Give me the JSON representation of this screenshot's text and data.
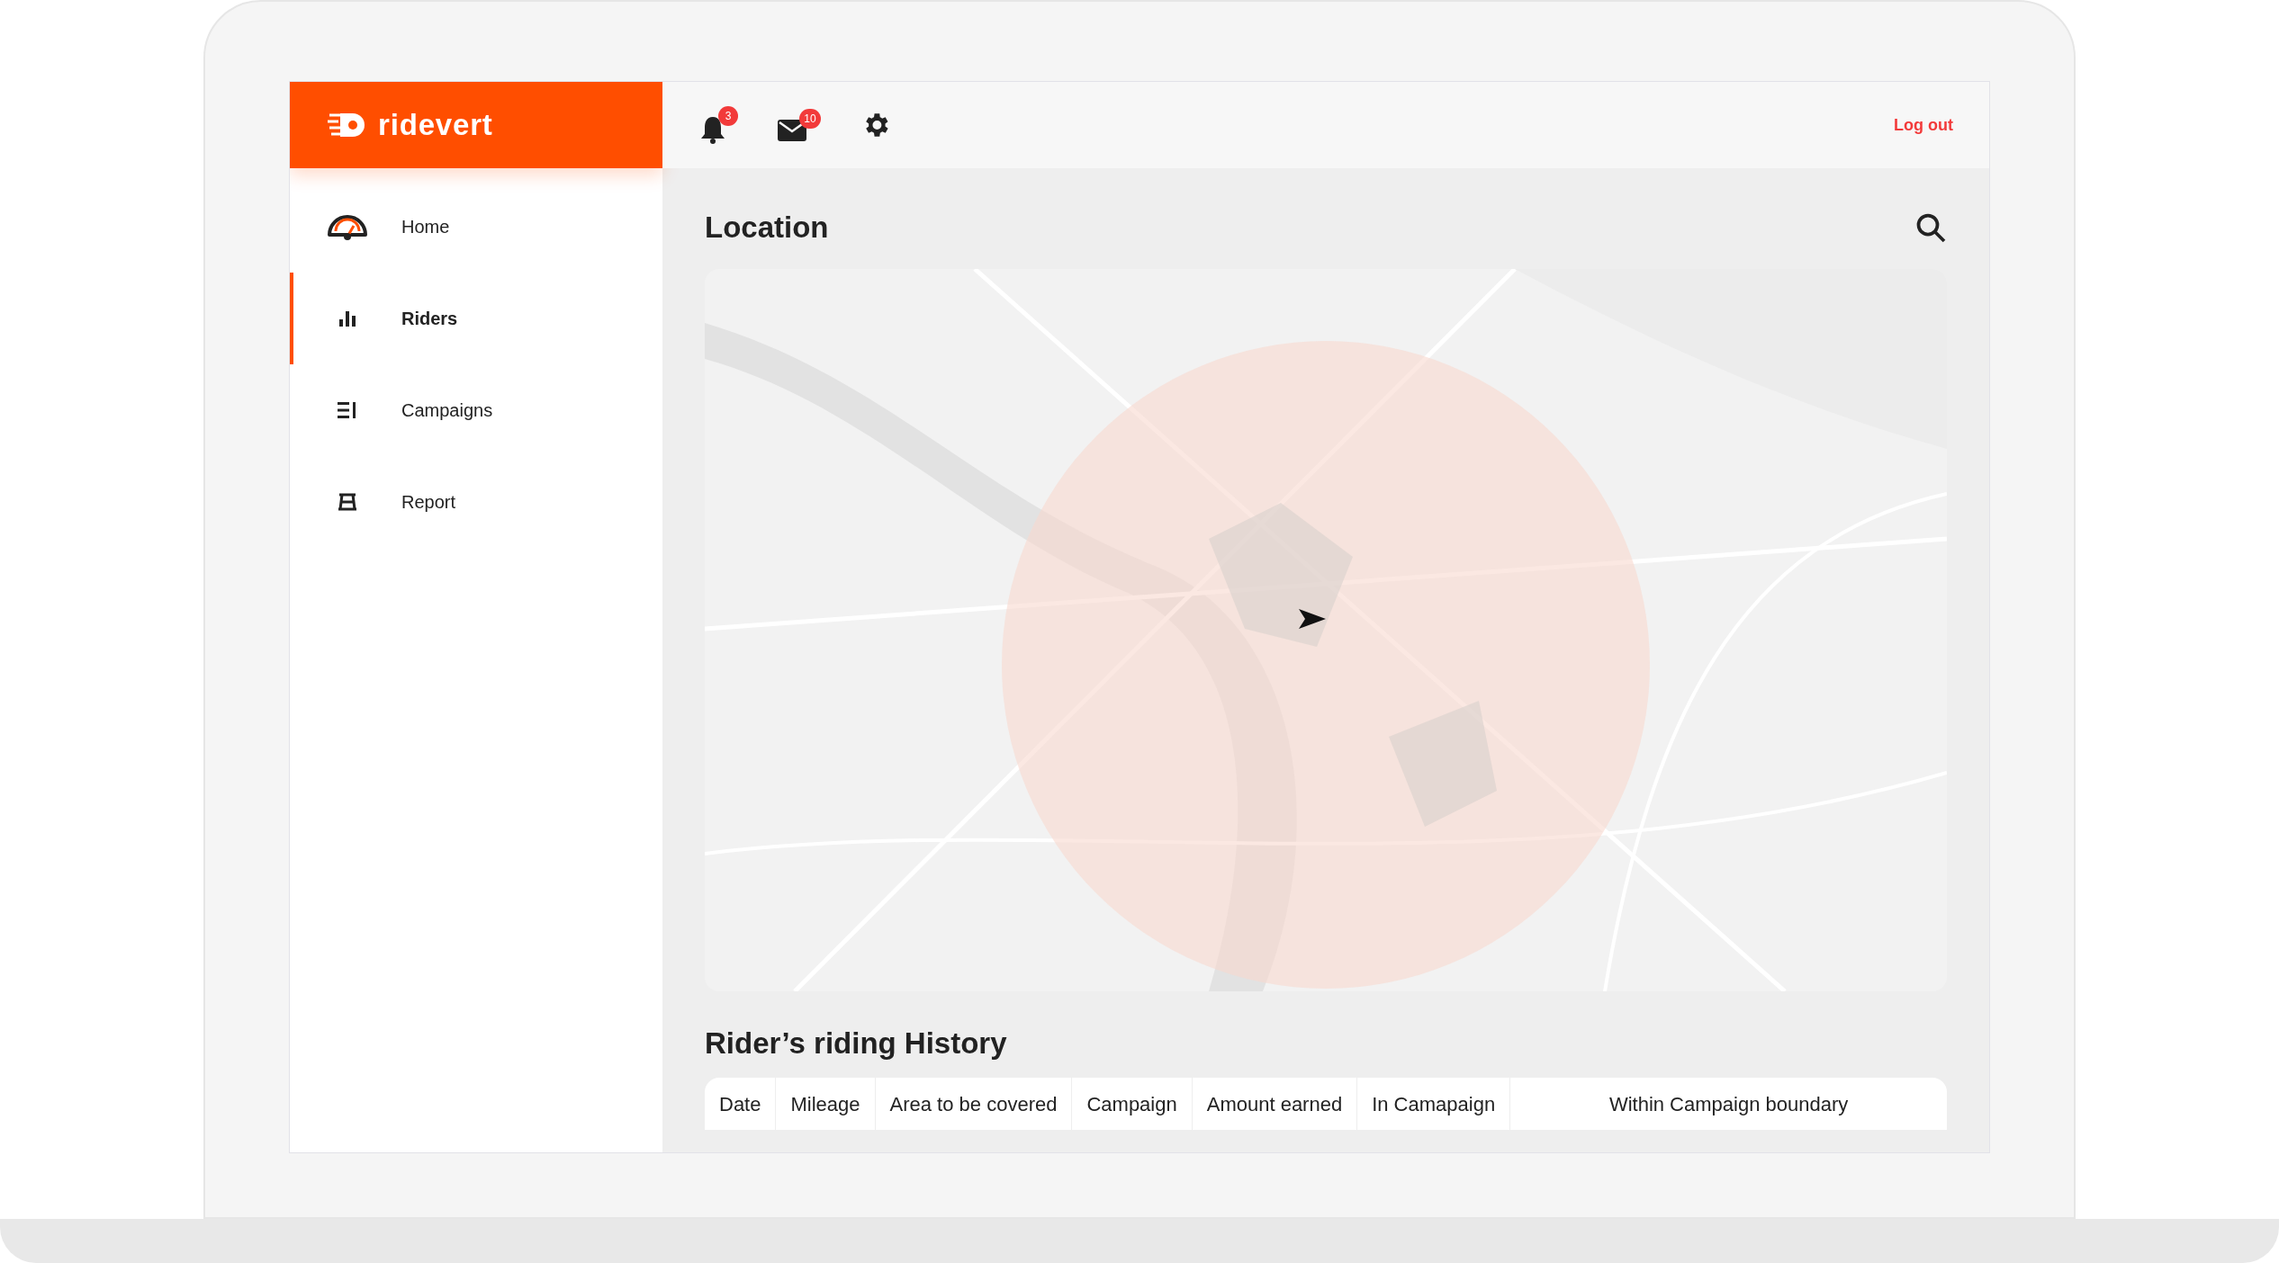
{
  "brand": {
    "name": "ridevert"
  },
  "header": {
    "notifications": {
      "count": "3"
    },
    "messages": {
      "count": "10"
    },
    "logout": "Log out"
  },
  "sidebar": {
    "items": [
      {
        "label": "Home",
        "kind": "gauge",
        "selected": false
      },
      {
        "label": "Riders",
        "kind": "bars",
        "selected": true
      },
      {
        "label": "Campaigns",
        "kind": "list",
        "selected": false
      },
      {
        "label": "Report",
        "kind": "report",
        "selected": false
      }
    ]
  },
  "location": {
    "title": "Location"
  },
  "history": {
    "title": "Rider’s riding History",
    "columns": [
      "Date",
      "Mileage",
      "Area to be covered",
      "Campaign",
      "Amount earned",
      "In Camapaign",
      "Within Campaign boundary"
    ]
  }
}
